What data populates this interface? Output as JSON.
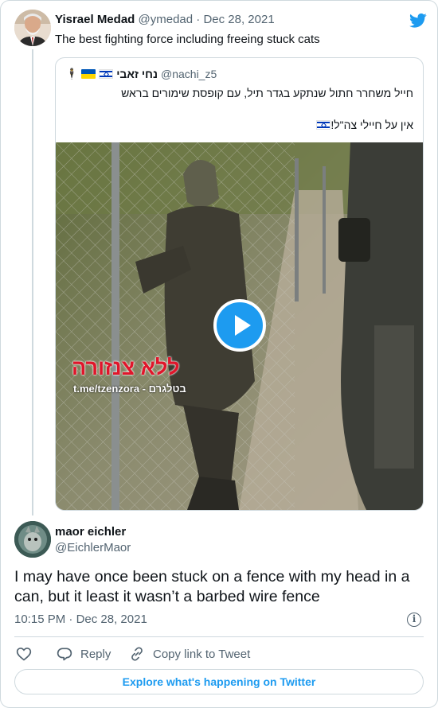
{
  "parent_tweet": {
    "author_name": "Yisrael Medad",
    "handle": "@ymedad",
    "separator": "·",
    "date": "Dec 28, 2021",
    "text": "The best fighting force including freeing stuck cats"
  },
  "quoted_tweet": {
    "emoji_soldier": "🕴",
    "author_name": "נחי זאבי",
    "handle": "@nachi_z5",
    "text_line1": "חייל משחרר חתול שנתקע בגדר תיל, עם קופסת שימורים בראש",
    "text_line2": "אין על חיילי צה\"ל!",
    "media": {
      "watermark_name": "ללא צנזורה",
      "watermark_link": "t.me/tzenzora - בטלגרם"
    }
  },
  "reply_tweet": {
    "author_name": "maor eichler",
    "handle": "@EichlerMaor",
    "text": "I may have once been stuck on a fence with my head in a can, but it least it wasn’t a barbed wire fence",
    "time": "10:15 PM",
    "separator": "·",
    "date": "Dec 28, 2021"
  },
  "actions": {
    "reply_label": "Reply",
    "copy_link_label": "Copy link to Tweet"
  },
  "explore_label": "Explore what's happening on Twitter",
  "colors": {
    "accent": "#1d9bf0",
    "text_primary": "#0f1419",
    "text_secondary": "#536471",
    "border": "#cfd9de"
  },
  "icons": [
    "twitter-bird-icon",
    "play-icon",
    "info-icon",
    "heart-icon",
    "reply-icon",
    "link-icon",
    "flag-israel-icon",
    "flag-ukraine-icon"
  ]
}
